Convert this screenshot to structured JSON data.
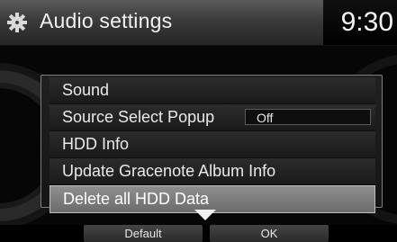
{
  "header": {
    "title": "Audio settings",
    "clock": "9:30",
    "icon": "gear-icon"
  },
  "menu": {
    "items": [
      {
        "label": "Sound"
      },
      {
        "label": "Source Select Popup",
        "value": "Off"
      },
      {
        "label": "HDD Info"
      },
      {
        "label": "Update Gracenote Album Info"
      },
      {
        "label": "Delete all HDD Data",
        "selected": true
      }
    ]
  },
  "footer": {
    "default_label": "Default",
    "ok_label": "OK"
  },
  "colors": {
    "selected_bg": "#7d7d7d",
    "text": "#eaeaea"
  }
}
